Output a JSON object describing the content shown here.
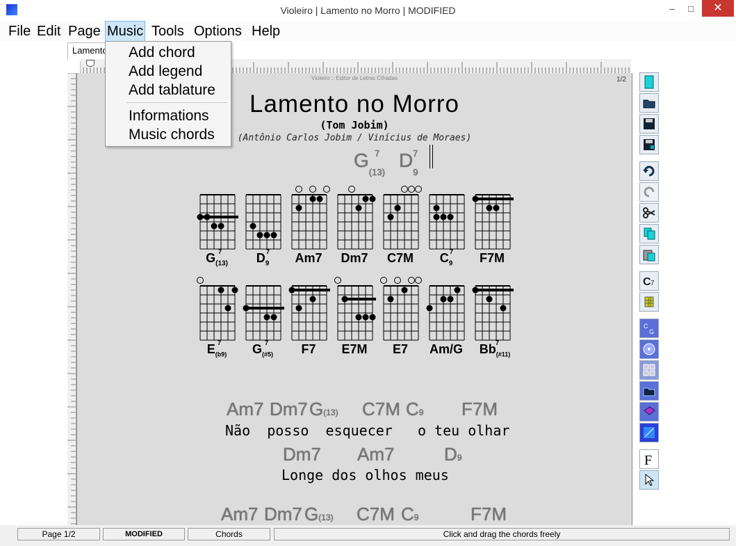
{
  "window": {
    "title": "Violeiro | Lamento no Morro | MODIFIED",
    "minimize": "–",
    "maximize": "□",
    "close": "✕"
  },
  "menu": [
    "File",
    "Edit",
    "Page",
    "Music",
    "Tools",
    "Options",
    "Help"
  ],
  "music_menu": {
    "items": [
      "Add chord",
      "Add legend",
      "Add tablature",
      "Informations",
      "Music chords"
    ]
  },
  "tab": {
    "label": "Lamento no Morro.cif"
  },
  "page": {
    "header": "Violeiro :: Editor de Letras Cifradas",
    "page_number": "1/2",
    "song_title": "Lamento no Morro",
    "composer": "(Tom Jobim)",
    "authors": "(Antônio Carlos Jobim / Vinícius de Moraes)",
    "intro_chords": [
      {
        "root": "G",
        "sup": "7",
        "sub": "(13)"
      },
      {
        "root": "D",
        "sup": "7",
        "sub": "9"
      }
    ],
    "diagram_row1": [
      "G",
      "D",
      "Am7",
      "Dm7",
      "C7M",
      "C",
      "F7M"
    ],
    "diagram_row1_sup": [
      "7",
      "7",
      "",
      "",
      "",
      "7",
      ""
    ],
    "diagram_row1_sub": [
      "(13)",
      "9",
      "",
      "",
      "",
      "9",
      ""
    ],
    "diagram_row2": [
      "E",
      "G",
      "F7",
      "E7M",
      "E7",
      "Am/G",
      "Bb"
    ],
    "diagram_row2_sup": [
      "7",
      "7",
      "",
      "",
      "",
      "",
      "7"
    ],
    "diagram_row2_sub": [
      "(b9)",
      "(#5)",
      "",
      "",
      "",
      "",
      "(#11)"
    ],
    "verse1_chords": [
      "Am7",
      "Dm7",
      "G",
      "C7M",
      "C",
      "F7M"
    ],
    "verse1_lyric": "Não  posso  esquecer   o teu olhar",
    "verse2_chords": [
      "Dm7",
      "Am7",
      "D"
    ],
    "verse2_lyric": "Longe dos olhos meus",
    "verse3_chords": [
      "Am7",
      "Dm7",
      "G",
      "C7M",
      "C",
      "F7M"
    ]
  },
  "status": {
    "page": "Page 1/2",
    "state": "MODIFIED",
    "mode": "Chords",
    "hint": "Click and drag the chords freely"
  },
  "colors": {
    "accent": "#cde6f7",
    "close": "#c7372f",
    "page_bg": "#dcdcdc"
  }
}
